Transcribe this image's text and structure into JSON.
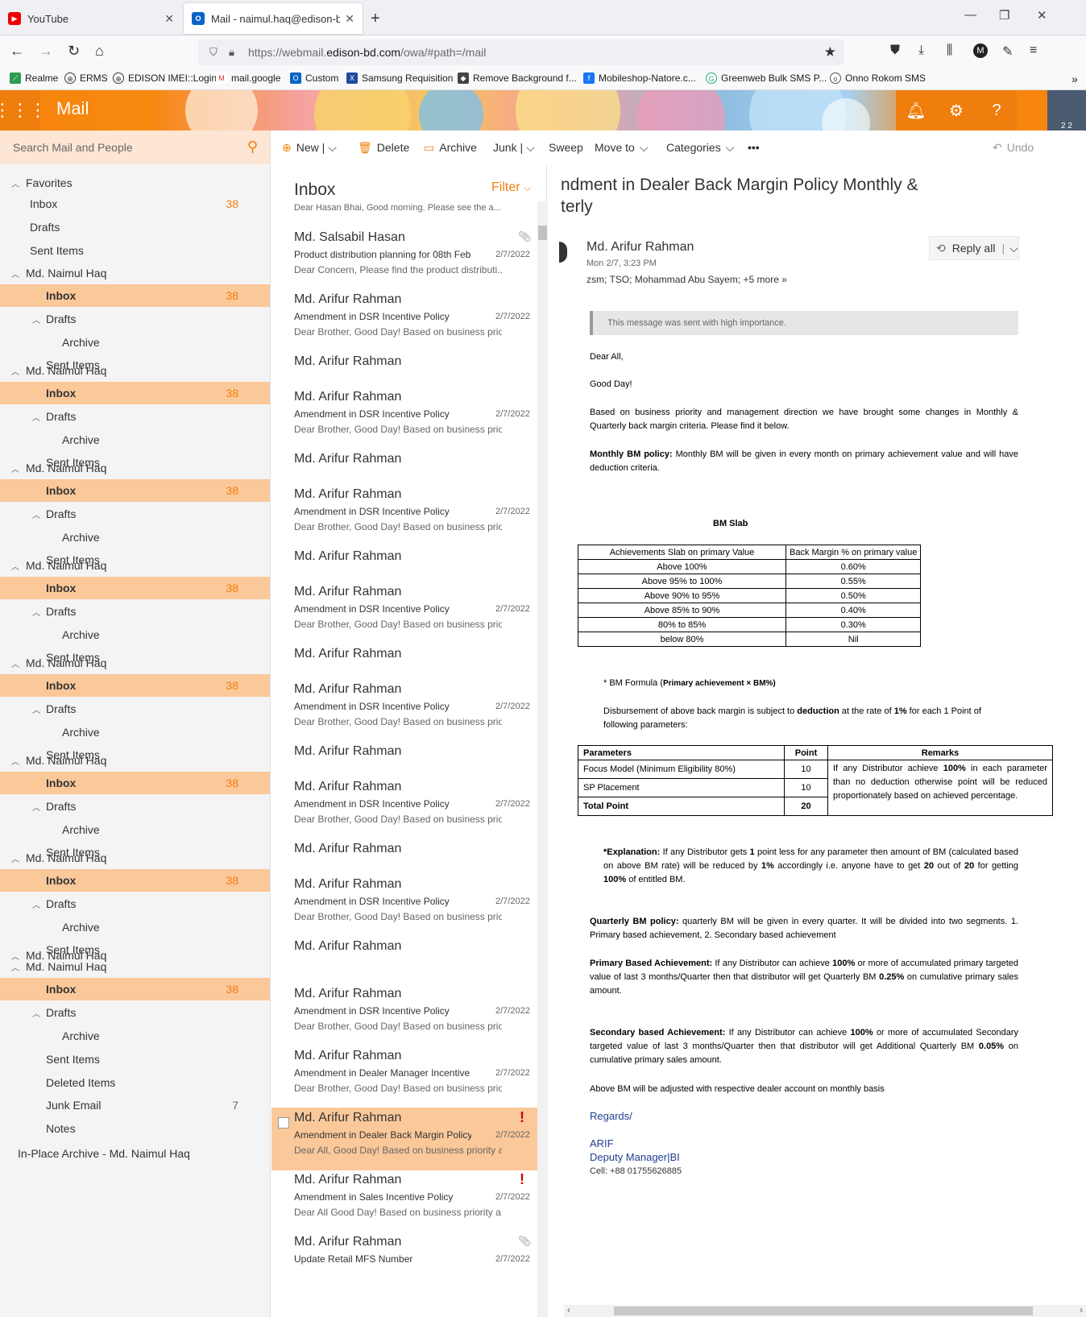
{
  "browser": {
    "tabs": [
      {
        "title": "YouTube"
      },
      {
        "title": "Mail - naimul.haq@edison-bd.c"
      }
    ],
    "url_prefix": "https://webmail.",
    "url_domain": "edison-bd.com",
    "url_suffix": "/owa/#path=/mail",
    "bookmarks": [
      "Realme",
      "ERMS",
      "EDISON IMEI::Login",
      "mail.google",
      "Custom",
      "Samsung Requisition",
      "Remove Background f...",
      "Mobileshop-Natore.c...",
      "Greenweb Bulk SMS P...",
      "Onno Rokom SMS"
    ]
  },
  "owa": {
    "app_name": "Mail",
    "avatar_badge": "2 2"
  },
  "commands": {
    "new": "New",
    "delete": "Delete",
    "archive": "Archive",
    "junk": "Junk",
    "sweep": "Sweep",
    "move_to": "Move to",
    "categories": "Categories",
    "more": "•••",
    "undo": "Undo"
  },
  "search": {
    "placeholder": "Search Mail and People"
  },
  "folders": {
    "favorites": "Favorites",
    "fav_inbox": "Inbox",
    "fav_inbox_count": "38",
    "fav_drafts": "Drafts",
    "fav_sent": "Sent Items",
    "account": "Md. Naimul Haq",
    "inbox": "Inbox",
    "inbox_count": "38",
    "drafts": "Drafts",
    "archive": "Archive",
    "sent": "Sent Items",
    "deleted": "Deleted Items",
    "junk": "Junk Email",
    "junk_count": "7",
    "notes": "Notes",
    "inplace": "In-Place Archive - Md. Naimul Haq"
  },
  "list": {
    "title": "Inbox",
    "filter": "Filter",
    "top_preview": "Dear Hasan Bhai,   Good morning. Please see the a...",
    "messages": [
      {
        "from": "Md. Salsabil Hasan",
        "subject": "Product distribution planning for 08th Feb",
        "date": "2/7/2022",
        "preview": "Dear Concern,     Please find the product distributi..."
      },
      {
        "from": "Md. Arifur Rahman",
        "subject": "Amendment in DSR Incentive Policy",
        "date": "2/7/2022",
        "preview": "Dear Brother,   Good Day!   Based on business prior..."
      },
      {
        "from": "Md. Arifur Rahman"
      },
      {
        "from": "Md. Arifur Rahman",
        "subject": "Amendment in DSR Incentive Policy",
        "date": "2/7/2022",
        "preview": "Dear Brother,   Good Day!   Based on business prior..."
      },
      {
        "from": "Md. Arifur Rahman"
      },
      {
        "from": "Md. Arifur Rahman",
        "subject": "Amendment in DSR Incentive Policy",
        "date": "2/7/2022",
        "preview": "Dear Brother,   Good Day!   Based on business prior..."
      },
      {
        "from": "Md. Arifur Rahman"
      },
      {
        "from": "Md. Arifur Rahman",
        "subject": "Amendment in DSR Incentive Policy",
        "date": "2/7/2022",
        "preview": "Dear Brother,   Good Day!   Based on business prior..."
      },
      {
        "from": "Md. Arifur Rahman"
      },
      {
        "from": "Md. Arifur Rahman",
        "subject": "Amendment in DSR Incentive Policy",
        "date": "2/7/2022",
        "preview": "Dear Brother,   Good Day!   Based on business prior..."
      },
      {
        "from": "Md. Arifur Rahman"
      },
      {
        "from": "Md. Arifur Rahman",
        "subject": "Amendment in DSR Incentive Policy",
        "date": "2/7/2022",
        "preview": "Dear Brother,   Good Day!   Based on business prior..."
      },
      {
        "from": "Md. Arifur Rahman"
      },
      {
        "from": "Md. Arifur Rahman",
        "subject": "Amendment in DSR Incentive Policy",
        "date": "2/7/2022",
        "preview": "Dear Brother,   Good Day!   Based on business prior..."
      },
      {
        "from": "Md. Arifur Rahman"
      },
      {
        "from": "Md. Arifur Rahman",
        "subject": "Amendment in DSR Incentive Policy",
        "date": "2/7/2022",
        "preview": "Dear Brother,   Good Day!   Based on business prior..."
      },
      {
        "from": "Md. Arifur Rahman",
        "subject": "Amendment in Dealer Manager Incentive F",
        "date": "2/7/2022",
        "preview": "Dear Brother,   Good Day!   Based on business prior..."
      },
      {
        "from": "Md. Arifur Rahman",
        "subject": "Amendment in Dealer Back Margin Policy",
        "date": "2/7/2022",
        "preview": "Dear All,   Good Day!   Based on business priority a..."
      },
      {
        "from": "Md. Arifur Rahman",
        "subject": "Amendment in Sales Incentive Policy",
        "date": "2/7/2022",
        "preview": "Dear All   Good Day!   Based on business priority a..."
      },
      {
        "from": "Md. Arifur Rahman",
        "subject": "Update Retail MFS Number",
        "date": "2/7/2022"
      }
    ]
  },
  "reading": {
    "subject_line1": "ndment in Dealer Back Margin Policy Monthly &",
    "subject_line2": "terly",
    "from": "Md. Arifur Rahman",
    "date": "Mon 2/7, 3:23 PM",
    "to": "zsm; TSO; Mohammad Abu Sayem;",
    "more_recipients": "+5 more",
    "reply_all": "Reply all",
    "importance": "This message was sent with high importance.",
    "greeting": "Dear All,",
    "goodday": "Good Day!",
    "intro": "Based on business priority and management direction we have brought some changes in Monthly & Quarterly back margin criteria. Please find it below.",
    "monthly_label": "Monthly BM policy:",
    "monthly_text": " Monthly BM will be given in every month on primary achievement value and will have deduction criteria.",
    "slab_title": "BM Slab",
    "slab_headers": [
      "Achievements Slab on primary Value",
      "Back Margin % on primary value"
    ],
    "slab_rows": [
      [
        "Above 100%",
        "0.60%"
      ],
      [
        "Above 95% to 100%",
        "0.55%"
      ],
      [
        "Above 90% to 95%",
        "0.50%"
      ],
      [
        "Above 85% to 90%",
        "0.40%"
      ],
      [
        "80% to 85%",
        "0.30%"
      ],
      [
        "below 80%",
        "Nil"
      ]
    ],
    "formula_a": "* BM Formula (",
    "formula_b": "Primary achievement × BM%)",
    "disb_a": "Disbursement of above back margin is subject to ",
    "disb_b": "deduction",
    "disb_c": " at the rate of ",
    "disb_d": "1%",
    "disb_e": " for each 1 Point of following parameters:",
    "param_headers": [
      "Parameters",
      "Point",
      "Remarks"
    ],
    "param_rows": [
      [
        "Focus Model (Minimum Eligibility 80%)",
        "10"
      ],
      [
        "SP Placement",
        "10"
      ],
      [
        "Total Point",
        "20"
      ]
    ],
    "remarks_a": "If any Distributor achieve ",
    "remarks_b": "100%",
    "remarks_c": " in each parameter than no deduction otherwise point will be reduced proportionately based on achieved percentage.",
    "expl_label": "*Explanation:",
    "expl_a": " If any Distributor gets ",
    "expl_b": "1",
    "expl_c": " point less for any parameter then amount of BM (calculated based on above BM rate) will be reduced by ",
    "expl_d": "1%",
    "expl_e": " accordingly i.e. anyone have to get ",
    "expl_f": "20",
    "expl_g": " out of ",
    "expl_h": "20",
    "expl_i": " for getting ",
    "expl_j": "100%",
    "expl_k": " of entitled BM.",
    "quarterly_label": "Quarterly BM policy:",
    "quarterly_text": " quarterly BM will be given in every quarter. It will be divided into two segments. 1. Primary based achievement, 2. Secondary based achievement",
    "primary_label": "Primary Based Achievement:",
    "primary_a": " If any Distributor can achieve ",
    "primary_b": "100%",
    "primary_c": " or more of accumulated primary targeted value of last 3 months/Quarter then that distributor will get Quarterly BM ",
    "primary_d": "0.25%",
    "primary_e": " on cumulative primary sales amount.",
    "secondary_label": "Secondary based Achievement:",
    "secondary_a": " If any Distributor can achieve ",
    "secondary_b": "100%",
    "secondary_c": " or more of accumulated Secondary targeted value of last 3 months/Quarter then that distributor will get Additional Quarterly BM ",
    "secondary_d": "0.05%",
    "secondary_e": " on cumulative primary sales amount.",
    "closing": "Above BM will be adjusted with respective dealer account on monthly basis",
    "regards": "Regards/",
    "sig_name": "ARIF",
    "sig_title": "Deputy Manager|BI",
    "sig_cell": "Cell: +88 01755626885"
  },
  "colors": {
    "accent": "#f07e0c",
    "selected": "#fbc89a",
    "importance": "#c00000"
  }
}
